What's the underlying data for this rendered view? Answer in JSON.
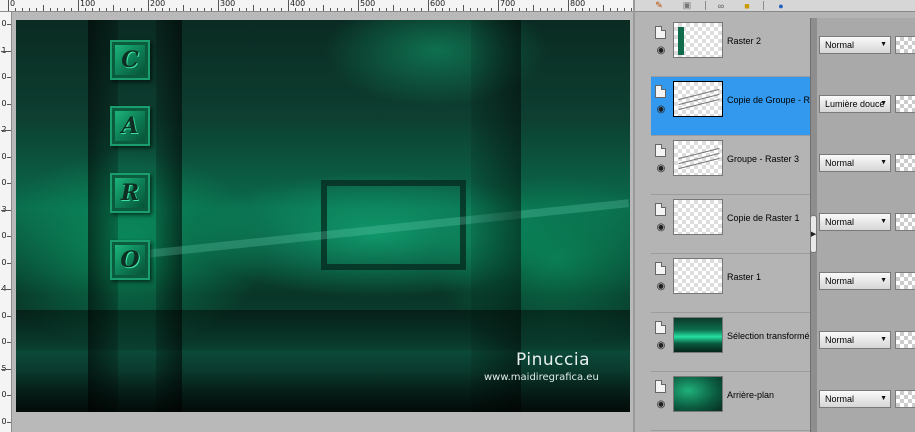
{
  "ruler_top": [
    "0",
    "100",
    "200",
    "300",
    "400",
    "500",
    "600",
    "700",
    "800"
  ],
  "ruler_left": [
    "0",
    "1",
    "0",
    "0",
    "2",
    "0",
    "0",
    "3",
    "0",
    "0",
    "4",
    "0",
    "0",
    "5",
    "0",
    "0"
  ],
  "canvas": {
    "tiles": [
      "C",
      "A",
      "R",
      "O"
    ],
    "signature_name": "Pinuccia",
    "signature_url": "www.maidiregrafica.eu"
  },
  "toolbar": {
    "icons": [
      "brush-icon",
      "mask-icon",
      "link-icon",
      "lock-icon",
      "globe-icon"
    ]
  },
  "layers": [
    {
      "name": "Raster 2",
      "blend": "Normal",
      "thumb": "c-column",
      "selected": false
    },
    {
      "name": "Copie de Groupe - R",
      "blend": "Lumière douce",
      "thumb": "streaks",
      "selected": true
    },
    {
      "name": "Groupe - Raster 3",
      "blend": "Normal",
      "thumb": "streaks",
      "selected": false
    },
    {
      "name": "Copie de Raster 1",
      "blend": "Normal",
      "thumb": "empty",
      "selected": false
    },
    {
      "name": "Raster 1",
      "blend": "Normal",
      "thumb": "empty",
      "selected": false
    },
    {
      "name": "Sélection transformé",
      "blend": "Normal",
      "thumb": "dark",
      "selected": false
    },
    {
      "name": "Arrière-plan",
      "blend": "Normal",
      "thumb": "green",
      "selected": false
    }
  ],
  "colors": {
    "selection": "#3399ee",
    "tile_green": "#1fbf83",
    "canvas_dark": "#0a2a22"
  }
}
